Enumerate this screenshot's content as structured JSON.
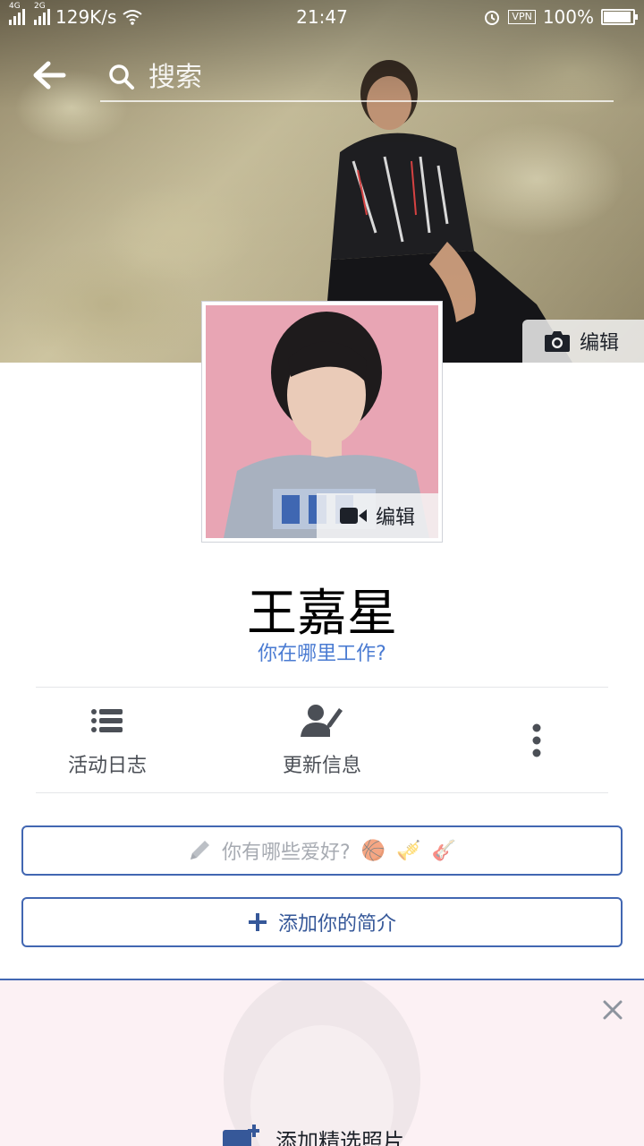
{
  "status_bar": {
    "network_1": "4G",
    "network_2": "2G",
    "speed": "129K/s",
    "time": "21:47",
    "vpn": "VPN",
    "battery": "100%",
    "battery_level": 1.0
  },
  "search": {
    "placeholder": "搜索"
  },
  "cover": {
    "edit_label": "编辑"
  },
  "avatar": {
    "edit_label": "编辑"
  },
  "profile": {
    "name": "王嘉星",
    "work_prompt": "你在哪里工作?"
  },
  "actions": [
    {
      "label": "活动日志",
      "icon": "list-icon"
    },
    {
      "label": "更新信息",
      "icon": "edit-profile-icon"
    },
    {
      "label": "",
      "icon": "more-vertical-icon"
    }
  ],
  "hobbies": {
    "prompt": "你有哪些爱好?",
    "emojis": [
      "🏀",
      "🎺",
      "🎸"
    ]
  },
  "bio": {
    "label": "添加你的简介"
  },
  "featured": {
    "label": "添加精选照片"
  },
  "colors": {
    "accent": "#4267b2",
    "link": "#4a7bd2",
    "featured_bg": "#fcf1f4"
  }
}
